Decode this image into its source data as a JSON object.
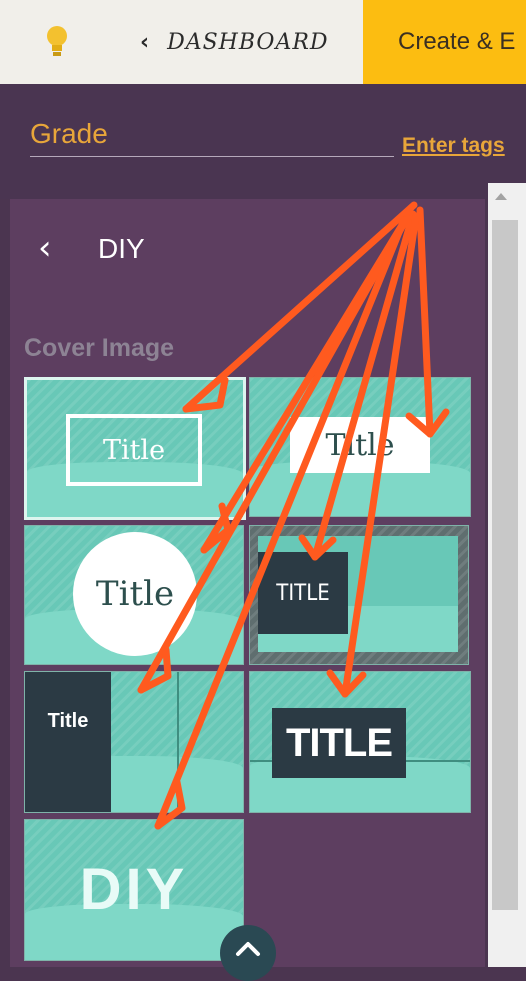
{
  "header": {
    "bulb_icon": "lightbulb-icon",
    "back_label": "DASHBOARD",
    "active_tab": "Create & E"
  },
  "form": {
    "grade_placeholder": "Grade",
    "tags_link": "Enter tags"
  },
  "panel": {
    "title": "DIY",
    "section_label": "Cover Image",
    "templates": [
      {
        "label": "Title",
        "style": "outlined-box"
      },
      {
        "label": "Title",
        "style": "white-banner"
      },
      {
        "label": "Title",
        "style": "circle"
      },
      {
        "label": "TITLE",
        "style": "dark-label"
      },
      {
        "label": "Title",
        "style": "dark-sidebar"
      },
      {
        "label": "TITLE",
        "style": "bold-banner"
      },
      {
        "label": "DIY",
        "style": "custom"
      }
    ]
  },
  "colors": {
    "topbar": "#f1efea",
    "active_tab": "#fcbd11",
    "background": "#4b3550",
    "panel": "#5d3e60",
    "accent_text": "#e8a63a",
    "tile_teal": "#68c8b7",
    "annotation_arrows": "#ff5a1f"
  }
}
